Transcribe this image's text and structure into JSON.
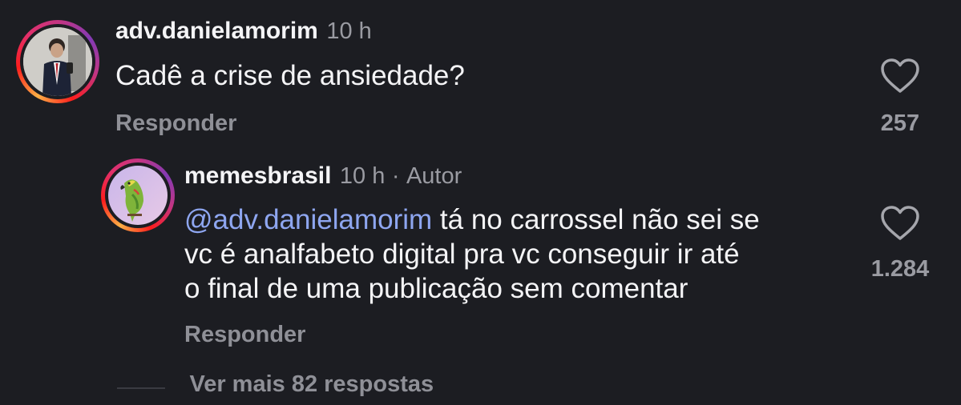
{
  "comments": [
    {
      "username": "adv.danielamorim",
      "time": "10 h",
      "text": "Cadê a crise de ansiedade?",
      "reply_label": "Responder",
      "like_count": "257",
      "icon": "heart-outline-icon"
    },
    {
      "username": "memesbrasil",
      "time": "10 h",
      "separator": "·",
      "author_badge": "Autor",
      "mention": "@adv.danielamorim",
      "text_line1": " tá no carrossel não sei se",
      "text_line2": "vc é analfabeto digital pra vc conseguir ir até",
      "text_line3": "o final de uma publicação sem comentar",
      "reply_label": "Responder",
      "like_count": "1.284",
      "icon": "heart-outline-icon"
    }
  ],
  "view_more_replies": "Ver mais 82 respostas"
}
